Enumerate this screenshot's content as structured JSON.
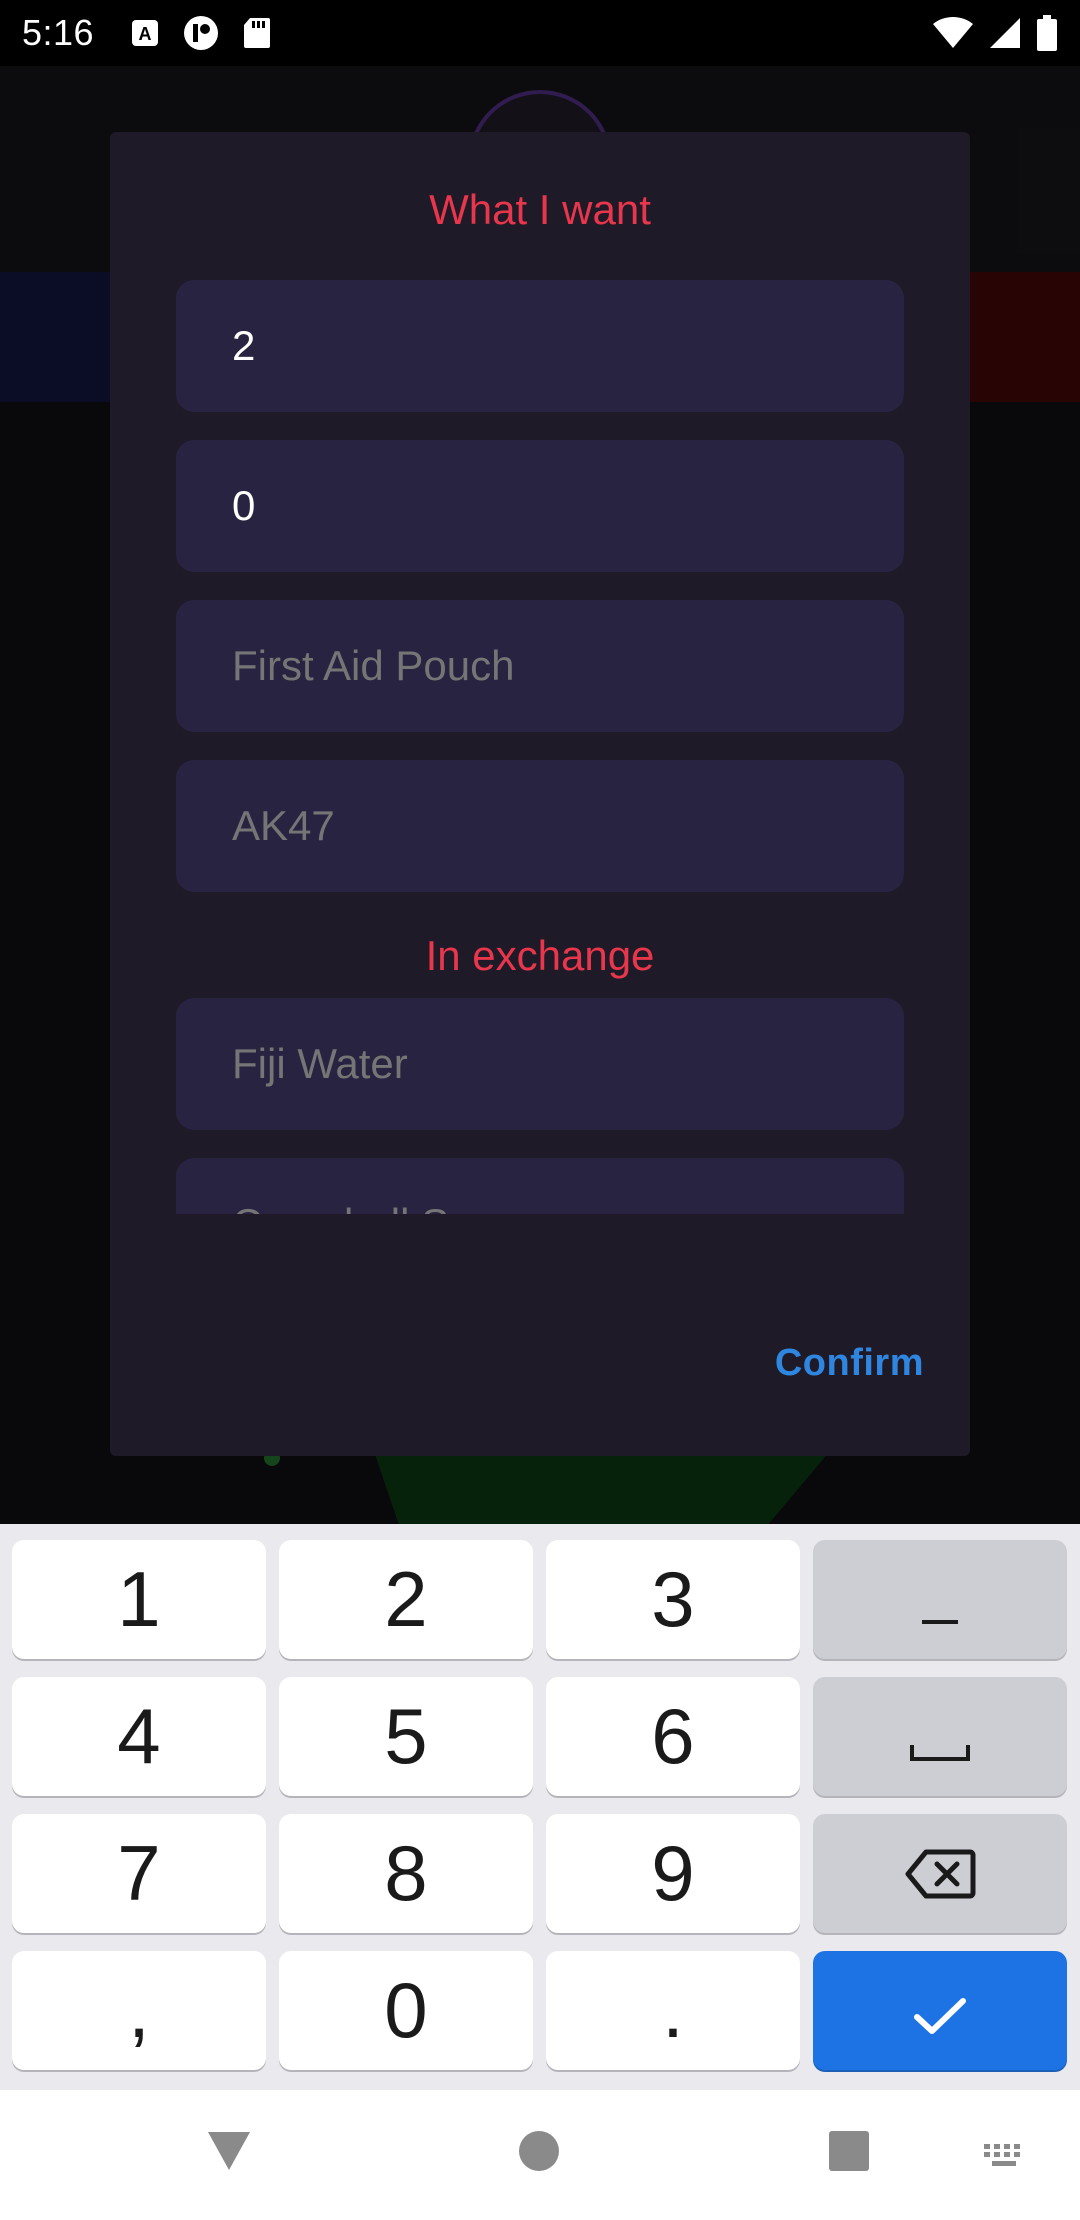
{
  "status_bar": {
    "time": "5:16",
    "left_icons": [
      "keyboard-a-icon",
      "app-notification-icon",
      "sd-card-icon"
    ],
    "right_icons": [
      "wifi-icon",
      "cellular-signal-icon",
      "battery-icon"
    ]
  },
  "dialog": {
    "want_title": "What I want",
    "want_fields": [
      {
        "value": "2",
        "placeholder": ""
      },
      {
        "value": "0",
        "placeholder": ""
      },
      {
        "value": "",
        "placeholder": "First Aid Pouch"
      },
      {
        "value": "",
        "placeholder": "AK47"
      }
    ],
    "exchange_title": "In exchange",
    "exchange_fields": [
      {
        "value": "",
        "placeholder": "Fiji Water"
      },
      {
        "value": "",
        "placeholder": "Campbell Soup"
      }
    ],
    "confirm_label": "Confirm"
  },
  "keyboard": {
    "rows": [
      [
        "1",
        "2",
        "3",
        "–"
      ],
      [
        "4",
        "5",
        "6",
        "␣"
      ],
      [
        "7",
        "8",
        "9",
        "⌫"
      ],
      [
        ",",
        "0",
        ".",
        "✓"
      ]
    ]
  },
  "nav_bar": {
    "icons": [
      "back-triangle-icon",
      "home-circle-icon",
      "recents-square-icon",
      "keyboard-switch-icon"
    ]
  },
  "colors": {
    "accent_red": "#e8364c",
    "hint_purple": "#6a5fb1",
    "confirm_blue": "#2f86e0",
    "enter_key_blue": "#1e73e4"
  }
}
